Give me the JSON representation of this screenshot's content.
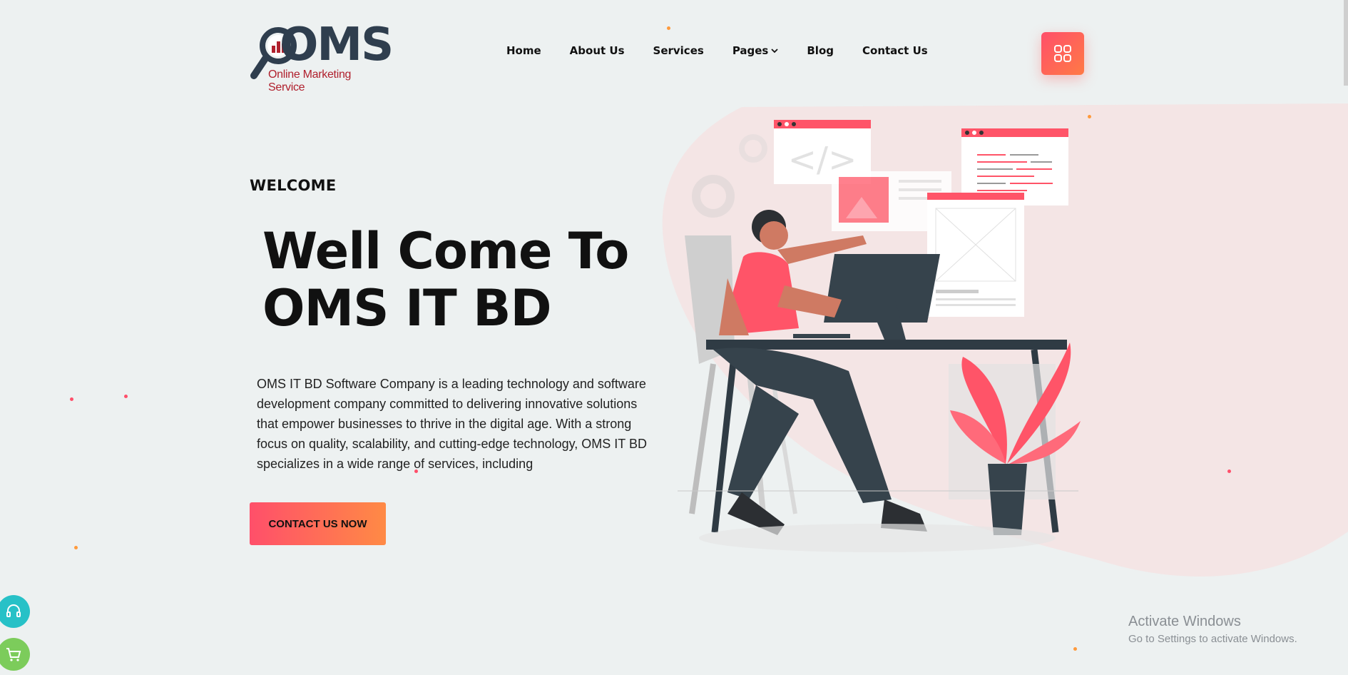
{
  "logo": {
    "wordmark": "OMS",
    "tagline": "Online Marketing Service"
  },
  "nav": {
    "items": [
      {
        "label": "Home"
      },
      {
        "label": "About Us"
      },
      {
        "label": "Services"
      },
      {
        "label": "Pages",
        "has_dropdown": true
      },
      {
        "label": "Blog"
      },
      {
        "label": "Contact Us"
      }
    ],
    "menu_icon": "grid-icon"
  },
  "hero": {
    "eyebrow": "WELCOME",
    "headline_line1": "Well Come To",
    "headline_line2": "OMS IT BD",
    "description": "OMS IT BD Software Company is a leading technology and software development company committed to delivering innovative solutions that empower businesses to thrive in the digital age. With a strong focus on quality, scalability, and cutting-edge technology, OMS IT BD specializes in a wide range of services, including",
    "cta_label": "CONTACT US NOW"
  },
  "floating": {
    "support_icon": "headset-icon",
    "cart_icon": "cart-icon"
  },
  "watermark": {
    "title": "Activate Windows",
    "subtitle": "Go to Settings to activate Windows."
  },
  "colors": {
    "accent_start": "#ff4f6a",
    "accent_end": "#ff8a45",
    "dark": "#2f3e4e",
    "background": "#edf1f1"
  }
}
